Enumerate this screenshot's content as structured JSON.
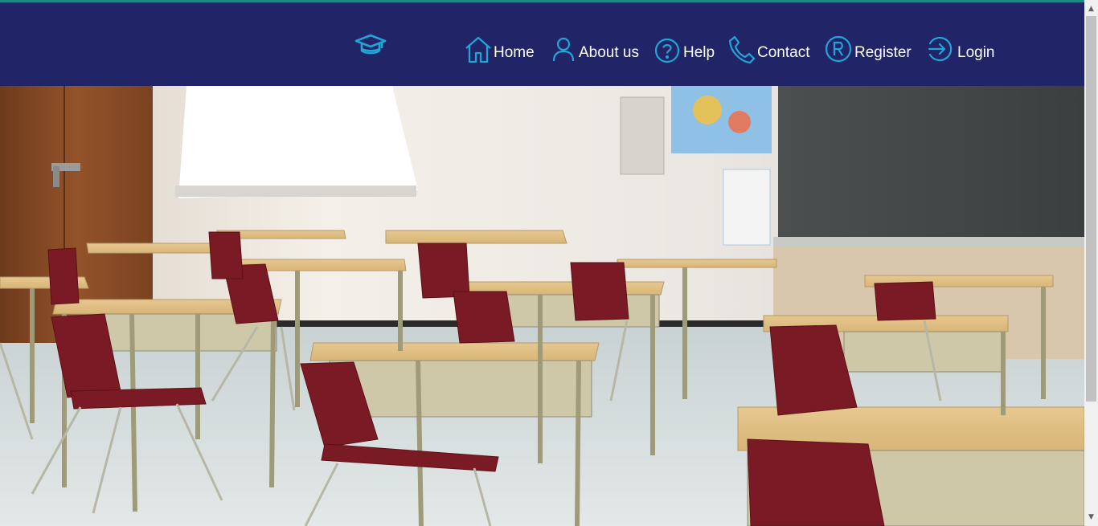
{
  "nav": {
    "logo_icon": "graduation-cap-icon",
    "items": [
      {
        "label": "Home",
        "icon": "house-icon"
      },
      {
        "label": "About us",
        "icon": "person-icon"
      },
      {
        "label": "Help",
        "icon": "question-circle-icon"
      },
      {
        "label": "Contact",
        "icon": "phone-icon"
      },
      {
        "label": "Register",
        "icon": "registered-circle-icon"
      },
      {
        "label": "Login",
        "icon": "login-arrow-icon"
      }
    ]
  },
  "hero": {
    "image": "classroom-photo"
  },
  "colors": {
    "navbar_bg": "#212466",
    "icon_accent": "#1fa5d6",
    "nav_text": "#ffffff",
    "top_accent": "#1f8a8a"
  }
}
